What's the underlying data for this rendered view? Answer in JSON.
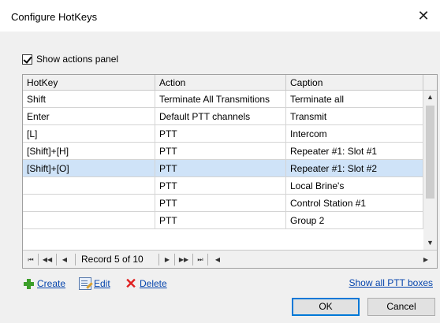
{
  "window": {
    "title": "Configure HotKeys",
    "close_glyph": "✕"
  },
  "show_actions_panel": {
    "label": "Show actions panel",
    "checked": true
  },
  "grid": {
    "columns": [
      "HotKey",
      "Action",
      "Caption"
    ],
    "rows": [
      {
        "hotkey": "Shift",
        "action": "Terminate All Transmitions",
        "caption": "Terminate all"
      },
      {
        "hotkey": "Enter",
        "action": "Default PTT channels",
        "caption": "Transmit"
      },
      {
        "hotkey": "[L]",
        "action": "PTT",
        "caption": "Intercom"
      },
      {
        "hotkey": "[Shift]+[H]",
        "action": "PTT",
        "caption": "Repeater #1: Slot #1"
      },
      {
        "hotkey": "[Shift]+[O]",
        "action": "PTT",
        "caption": "Repeater #1: Slot #2",
        "selected": true
      },
      {
        "hotkey": "",
        "action": "PTT",
        "caption": "Local Brine's"
      },
      {
        "hotkey": "",
        "action": "PTT",
        "caption": "Control Station #1"
      },
      {
        "hotkey": "",
        "action": "PTT",
        "caption": "Group 2"
      }
    ],
    "navigator": {
      "record_label": "Record 5 of 10",
      "first_icon": "first-record-icon",
      "prev_page_icon": "previous-page-icon",
      "prev_icon": "previous-record-icon",
      "next_icon": "next-record-icon",
      "next_page_icon": "next-page-icon",
      "last_icon": "last-record-icon"
    }
  },
  "actions": {
    "create": "Create",
    "edit": "Edit",
    "delete": "Delete",
    "show_all": "Show all PTT boxes"
  },
  "buttons": {
    "ok": "OK",
    "cancel": "Cancel"
  },
  "colors": {
    "selected_row": "#cfe3f8",
    "link": "#0645ad",
    "ok_border": "#0078d7"
  }
}
